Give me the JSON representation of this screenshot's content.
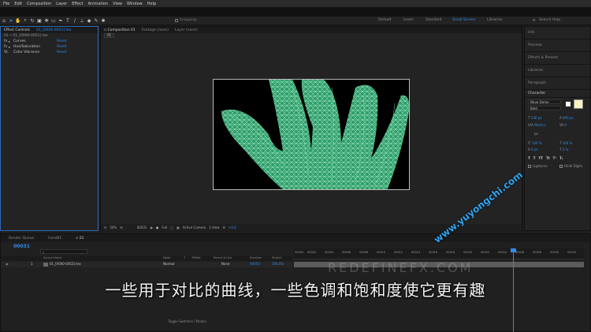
{
  "menu": [
    "File",
    "Edit",
    "Composition",
    "Layer",
    "Effect",
    "Animation",
    "View",
    "Window",
    "Help"
  ],
  "toolbar": {
    "snapping_label": "Snapping",
    "workspaces": [
      "Default",
      "Learn",
      "Standard",
      "Small Screen",
      "Libraries"
    ],
    "active_workspace": "Small Screen",
    "search_placeholder": "Search Help"
  },
  "effect_controls": {
    "tab": "Effect Controls",
    "tab_layer": "01_[0000-0052].tex",
    "source_line": "01 • 01_[0000-0052].tex",
    "effects": [
      {
        "prefix": "fx",
        "name": "Curves",
        "reset": "Reset"
      },
      {
        "prefix": "fx",
        "name": "Hue/Saturation",
        "reset": "Reset"
      },
      {
        "prefix": "VL",
        "name": "Color Vibrance",
        "reset": "Reset"
      }
    ]
  },
  "viewer": {
    "tabs": [
      "Composition 01",
      "Footage (none)",
      "Layer (none)"
    ],
    "comp_chip": "01",
    "zoom": "50%",
    "timecode": "00031",
    "resolution": "Full",
    "camera": "Active Camera",
    "views": "1 View",
    "exposure": "+0.0"
  },
  "right_panels": [
    "Info",
    "Preview",
    "Effects & Presets",
    "Libraries",
    "Paragraph"
  ],
  "character": {
    "title": "Character",
    "font": "Neue Demo",
    "style": "Bold",
    "size": "136 px",
    "leading": "895 px",
    "kerning": "Metrics",
    "tracking": "0",
    "unit": "px",
    "vscale": "100 %",
    "hscale": "100 %",
    "baseline": "0 px",
    "tsume": "0 %",
    "ligatures": "Ligatures",
    "hindi": "Hindi Digits",
    "fill_color": "#fbf3c2"
  },
  "timeline": {
    "tabs": [
      "Render Queue",
      "hand01",
      "01"
    ],
    "timecode": "00031",
    "columns": [
      "Source Name",
      "Mode",
      "T",
      "TrkMat",
      "Parent & Link",
      "Duration",
      "Stretch"
    ],
    "layer": {
      "index": "1",
      "name": "01_[0000-0052].tex",
      "mode": "Normal",
      "parent": "None",
      "duration": "00053",
      "stretch": "100.0%"
    },
    "ticks": [
      "00000",
      "00002",
      "00004",
      "00006",
      "00008",
      "00010",
      "00012",
      "00014",
      "00016",
      "00018",
      "00020",
      "00022",
      "00024",
      "00026",
      "00028",
      "00030",
      "00032"
    ],
    "footer": "Toggle Switches / Modes"
  },
  "overlay": {
    "subtitle": "一些用于对比的曲线，一些色调和饱和度使它更有趣",
    "brand_watermark": "REDEFINEFX.COM",
    "site_watermark": "www.yuyongchi.com"
  }
}
